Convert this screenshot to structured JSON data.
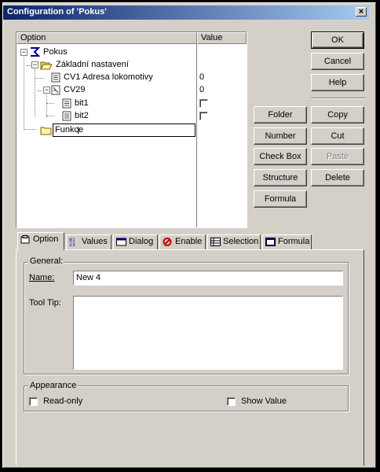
{
  "window": {
    "title": "Configuration of 'Pokus'",
    "close_glyph": "×"
  },
  "tree": {
    "headers": {
      "option": "Option",
      "value": "Value"
    },
    "nodes": {
      "root": "Pokus",
      "basic": "Základní nastavení",
      "cv1": "CV1 Adresa lokomotivy",
      "cv1_value": "0",
      "cv29": "CV29",
      "cv29_value": "0",
      "bit1": "bit1",
      "bit2": "bit2",
      "editing": "Funkce"
    }
  },
  "buttons": {
    "ok": "OK",
    "cancel": "Cancel",
    "help": "Help",
    "folder": "Folder",
    "copy": "Copy",
    "number": "Number",
    "cut": "Cut",
    "checkbox": "Check Box",
    "paste": "Paste",
    "structure": "Structure",
    "delete": "Delete",
    "formula": "Formula"
  },
  "tabs": [
    "Option",
    "Values",
    "Dialog",
    "Enable",
    "Selection",
    "Formula"
  ],
  "option_tab": {
    "general_label": "General:",
    "name_label": "Name:",
    "name_value": "New 4",
    "tooltip_label": "Tool Tip:",
    "tooltip_value": "",
    "appearance_label": "Appearance",
    "readonly_label": "Read-only",
    "showvalue_label": "Show Value"
  },
  "colors": {
    "title_start": "#0a246a",
    "title_end": "#a6caf0",
    "face": "#d4d0c8"
  }
}
